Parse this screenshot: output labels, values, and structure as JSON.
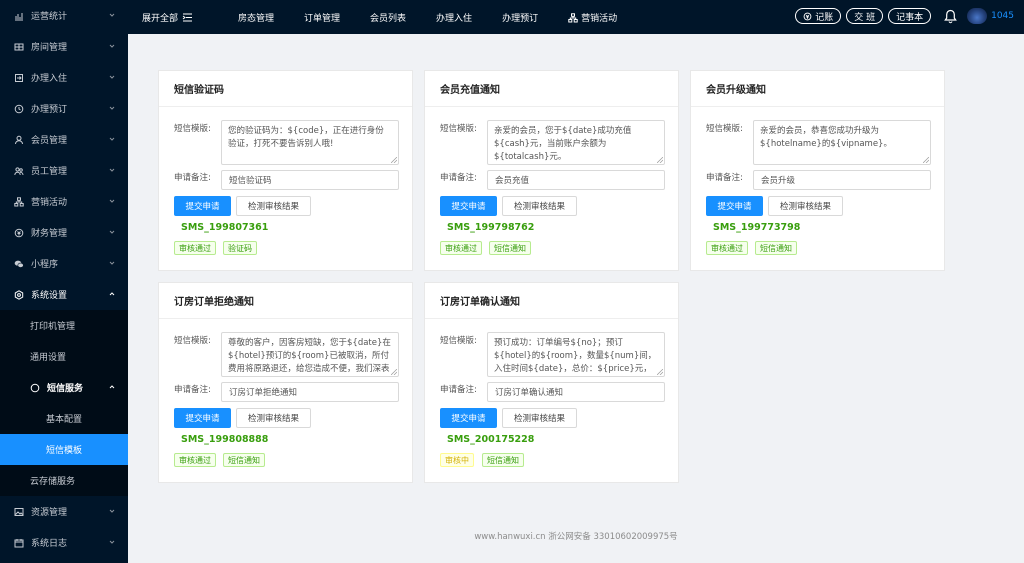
{
  "sidebar": {
    "items": [
      {
        "label": "运营统计",
        "icon": "bar-chart-icon"
      },
      {
        "label": "房间管理",
        "icon": "grid-icon"
      },
      {
        "label": "办理入住",
        "icon": "login-icon"
      },
      {
        "label": "办理预订",
        "icon": "clock-icon"
      },
      {
        "label": "会员管理",
        "icon": "user-icon"
      },
      {
        "label": "员工管理",
        "icon": "team-icon"
      },
      {
        "label": "营销活动",
        "icon": "cluster-icon"
      },
      {
        "label": "财务管理",
        "icon": "money-icon"
      },
      {
        "label": "小程序",
        "icon": "wechat-icon"
      },
      {
        "label": "系统设置",
        "icon": "setting-icon"
      },
      {
        "label": "打印机管理"
      },
      {
        "label": "通用设置"
      },
      {
        "label": "短信服务",
        "icon": "circle-icon"
      },
      {
        "label": "基本配置"
      },
      {
        "label": "短信模板"
      },
      {
        "label": "云存储服务"
      },
      {
        "label": "资源管理",
        "icon": "picture-icon"
      },
      {
        "label": "系统日志",
        "icon": "calendar-icon"
      }
    ]
  },
  "topbar": {
    "expand_label": "展开全部",
    "menu": [
      "房态管理",
      "订单管理",
      "会员列表",
      "办理入住",
      "办理预订",
      "营销活动"
    ],
    "pills": [
      "记账",
      "交 班",
      "记事本"
    ],
    "user_id": "1045"
  },
  "labels": {
    "template": "短信模版:",
    "remark": "申请备注:",
    "submit": "提交申请",
    "check": "检测审核结果"
  },
  "cards": [
    {
      "title": "短信验证码",
      "content": "您的验证码为：${code}，正在进行身份验证，打死不要告诉别人哦!",
      "remark": "短信验证码",
      "code": "SMS_199807361",
      "tags": [
        {
          "text": "审核通过"
        },
        {
          "text": "验证码"
        }
      ]
    },
    {
      "title": "会员充值通知",
      "content": "亲爱的会员，您于${date}成功充值${cash}元，当前账户余额为${totalcash}元。",
      "remark": "会员充值",
      "code": "SMS_199798762",
      "tags": [
        {
          "text": "审核通过"
        },
        {
          "text": "短信通知"
        }
      ]
    },
    {
      "title": "会员升级通知",
      "content": "亲爱的会员，恭喜您成功升级为${hotelname}的${vipname}。",
      "remark": "会员升级",
      "code": "SMS_199773798",
      "tags": [
        {
          "text": "审核通过"
        },
        {
          "text": "短信通知"
        }
      ]
    },
    {
      "title": "订房订单拒绝通知",
      "content": "尊敬的客户，因客房短缺，您于${date}在${hotel}预订的${room}已被取消，所付费用将原路退还，给您造成不便，我们深表歉意。",
      "remark": "订房订单拒绝通知",
      "code": "SMS_199808888",
      "tags": [
        {
          "text": "审核通过"
        },
        {
          "text": "短信通知"
        }
      ]
    },
    {
      "title": "订房订单确认通知",
      "content": "预订成功：订单编号${no}；预订${hotel}的${room}，数量${num}间，入住时间${date}，总价：${price}元，支付方式${paytype}。",
      "remark": "订房订单确认通知",
      "code": "SMS_200175228",
      "tags": [
        {
          "text": "审核中"
        },
        {
          "text": "短信通知"
        }
      ]
    }
  ],
  "footer": "www.hanwuxi.cn 浙公网安备 33010602009975号",
  "colors": {
    "primary": "#1890ff",
    "sidebar_bg": "#001529",
    "success": "#389e0d"
  }
}
